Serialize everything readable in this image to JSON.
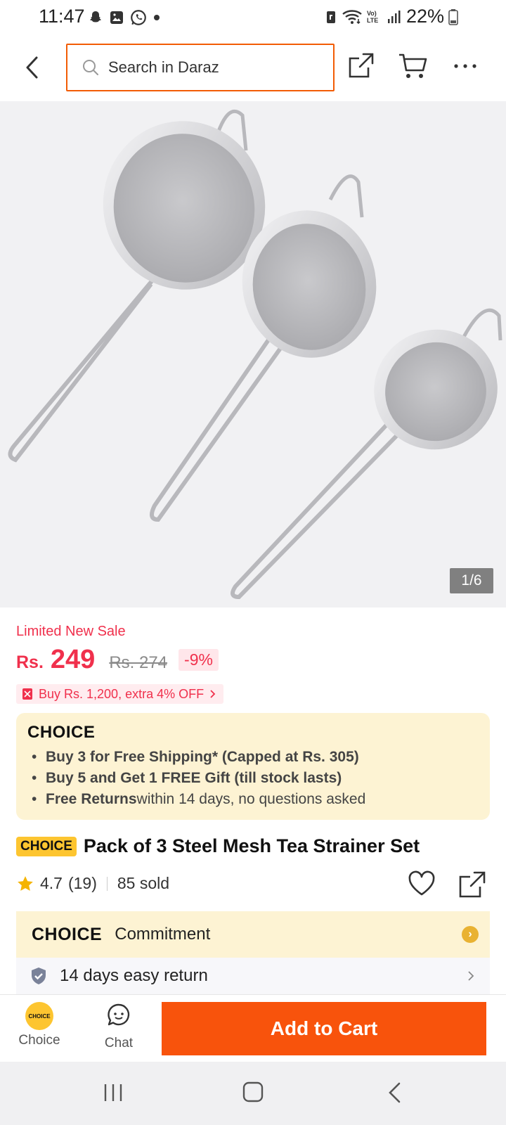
{
  "status_bar": {
    "time": "11:47",
    "battery": "22%",
    "lte": "Vo) LTE"
  },
  "topbar": {
    "search_placeholder": "Search in Daraz"
  },
  "gallery": {
    "counter": "1/6"
  },
  "price": {
    "sale_label": "Limited New Sale",
    "currency": "Rs.",
    "current": "249",
    "original": "Rs. 274",
    "discount": "-9%",
    "promo": "Buy Rs. 1,200, extra 4% OFF"
  },
  "choice": {
    "logo": "CHOICE",
    "benefits": [
      {
        "bold": "Buy 3 for  Free Shipping* (Capped at Rs. 305)",
        "rest": ""
      },
      {
        "bold": "Buy 5 and Get 1 FREE Gift (till stock lasts)",
        "rest": ""
      },
      {
        "bold": "Free Returns",
        "rest": " within 14 days, no questions asked"
      }
    ]
  },
  "product": {
    "badge": "CHOICE",
    "title": "Pack of 3 Steel Mesh Tea Strainer Set",
    "rating": "4.7",
    "reviews": "(19)",
    "sold": "85 sold"
  },
  "commitment": {
    "logo": "CHOICE",
    "label": "Commitment",
    "return_label": "14 days easy return"
  },
  "bottom_bar": {
    "choice_label": "Choice",
    "choice_badge": "CHOICE",
    "chat_label": "Chat",
    "add_to_cart": "Add to Cart"
  },
  "colors": {
    "brand_orange": "#f8530c",
    "sale_red": "#f0304c",
    "choice_yellow": "#fdc530",
    "choice_bg": "#fdf3d3"
  }
}
